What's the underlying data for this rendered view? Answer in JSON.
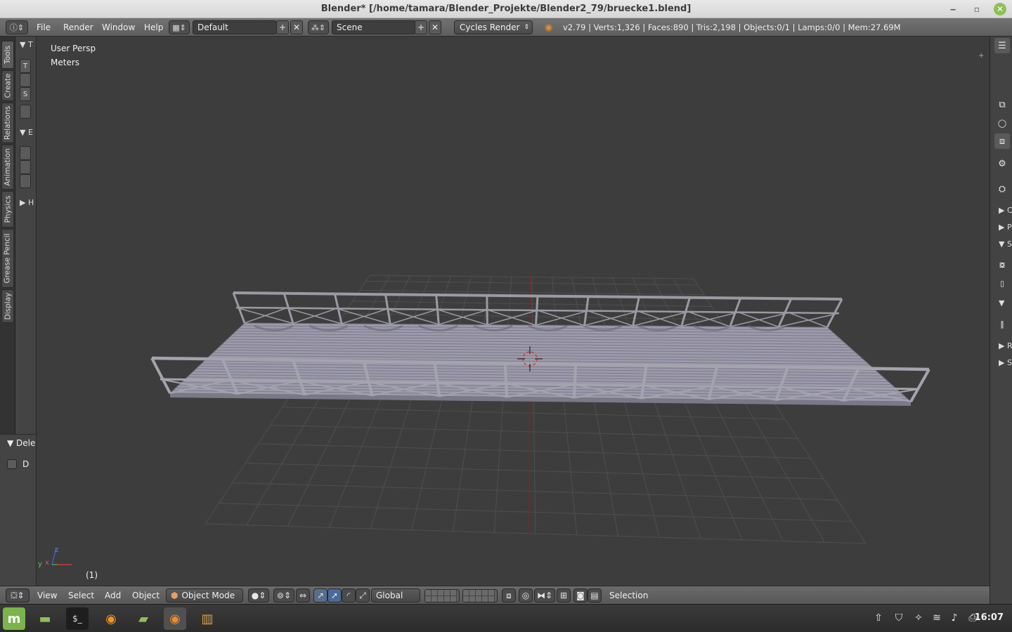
{
  "window": {
    "title": "Blender* [/home/tamara/Blender_Projekte/Blender2_79/bruecke1.blend]",
    "controls": {
      "minimize": "‒",
      "maximize": "▫",
      "close": "✕"
    }
  },
  "info_header": {
    "menus": [
      "File",
      "Render",
      "Window",
      "Help"
    ],
    "screen_layout": "Default",
    "scene": "Scene",
    "render_engine": "Cycles Render",
    "stats": "v2.79 | Verts:1,326 | Faces:890 | Tris:2,198 | Objects:0/1 | Lamps:0/0 | Mem:27.69M"
  },
  "tool_shelf": {
    "tabs": [
      "Tools",
      "Create",
      "Relations",
      "Animation",
      "Physics",
      "Grease Pencil",
      "Display"
    ],
    "panel_headers": [
      "T",
      "E",
      "H"
    ],
    "buttons": [
      "T",
      "S"
    ]
  },
  "operator_panel": {
    "title": "Dele",
    "checkbox_label": "D"
  },
  "viewport": {
    "view_name": "User Persp",
    "units": "Meters",
    "frame": "(1)",
    "axis_x": "x",
    "axis_y": "y",
    "axis_z": "z"
  },
  "properties_panel": {
    "rows": [
      "C",
      "P",
      "S",
      "R",
      "S"
    ]
  },
  "view3d_header": {
    "menus": [
      "View",
      "Select",
      "Add",
      "Object"
    ],
    "mode": "Object Mode",
    "orientation": "Global",
    "status": "Selection"
  },
  "taskbar": {
    "clock": "16:07"
  }
}
